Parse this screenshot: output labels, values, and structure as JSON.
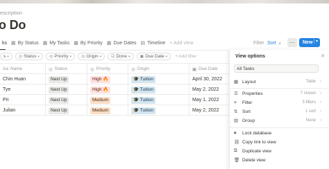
{
  "page": {
    "description": "escription",
    "title": "o Do"
  },
  "views": [
    {
      "label": "ks",
      "icon": "list-icon"
    },
    {
      "label": "By Status",
      "icon": "table-icon"
    },
    {
      "label": "My Tasks",
      "icon": "table-icon"
    },
    {
      "label": "By Priority",
      "icon": "table-icon"
    },
    {
      "label": "Due Dates",
      "icon": "table-icon"
    },
    {
      "label": "Timeline",
      "icon": "timeline-icon"
    },
    {
      "label": "+ Add view",
      "icon": ""
    }
  ],
  "toolbar": {
    "filter": "Filter",
    "sort": "Sort",
    "search_icon": "search-icon",
    "more": "···",
    "new": "New",
    "new_caret": "▾"
  },
  "filters": [
    {
      "label": "s",
      "icon": "",
      "has_caret": true
    },
    {
      "label": "Status",
      "icon": "status-icon"
    },
    {
      "label": "Priority",
      "icon": "priority-icon"
    },
    {
      "label": "Origin",
      "icon": "origin-icon"
    },
    {
      "label": "Done",
      "icon": "checkbox-icon"
    },
    {
      "label": "Due Date",
      "icon": "calendar-icon"
    }
  ],
  "add_filter": "+ Add filter",
  "table": {
    "columns": [
      "Name",
      "Status",
      "Priority",
      "Origin",
      "Due Date"
    ],
    "rows": [
      {
        "name": "Chin Huan",
        "status": "Next Up",
        "priority": "High 🔥",
        "origin": "🎓 Tuition",
        "due": "April 30, 2022"
      },
      {
        "name": "Tye",
        "status": "Next Up",
        "priority": "High 🔥",
        "origin": "🎓 Tuition",
        "due": "May 2, 2022"
      },
      {
        "name": "Pri",
        "status": "Next Up",
        "priority": "Medium",
        "origin": "🎓 Tuition",
        "due": "May 1, 2022"
      },
      {
        "name": "Julian",
        "status": "Next Up",
        "priority": "Medium",
        "origin": "🎓 Tuition",
        "due": "May 2, 2022"
      }
    ]
  },
  "panel": {
    "title": "View options",
    "close": "✕",
    "view_name": "All Tasks",
    "layout": {
      "label": "Layout",
      "value": "Table"
    },
    "properties": {
      "label": "Properties",
      "value": "7 shown"
    },
    "filter": {
      "label": "Filter",
      "value": "5 filters"
    },
    "sort": {
      "label": "Sort",
      "value": "1 sort"
    },
    "group": {
      "label": "Group",
      "value": "None"
    },
    "lock": "Lock database",
    "copy_link": "Copy link to view",
    "duplicate": "Duplicate view",
    "delete": "Delete view"
  },
  "colors": {
    "accent": "#2383e2",
    "tag_high": "#ffe2dd",
    "tag_medium": "#fadec9",
    "tag_origin": "#d3e5ef",
    "tag_status": "#e9e9e7"
  }
}
